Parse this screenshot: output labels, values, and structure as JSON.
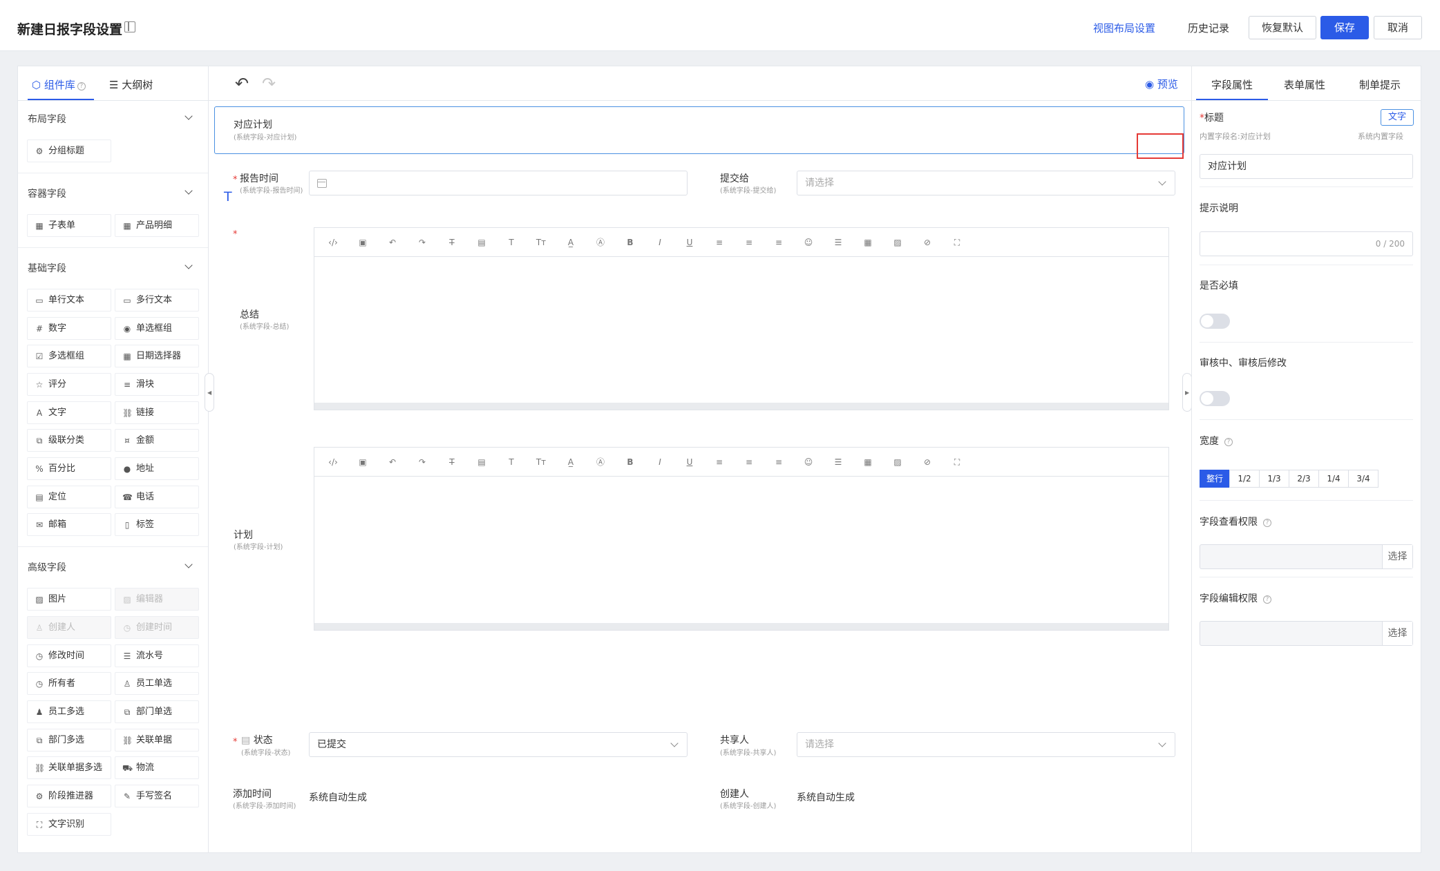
{
  "header": {
    "title": "新建日报字段设置",
    "view_layout": "视图布局设置",
    "history": "历史记录",
    "restore": "恢复默认",
    "save": "保存",
    "cancel": "取消",
    "accent": "#2b5be7"
  },
  "left": {
    "tabs": [
      "组件库",
      "大纲树"
    ],
    "sections": {
      "layout": {
        "title": "布局字段",
        "items": [
          "分组标题"
        ]
      },
      "container": {
        "title": "容器字段",
        "items": [
          "子表单",
          "产品明细"
        ]
      },
      "basic": {
        "title": "基础字段",
        "items": [
          "单行文本",
          "多行文本",
          "数字",
          "单选框组",
          "多选框组",
          "日期选择器",
          "评分",
          "滑块",
          "文字",
          "链接",
          "级联分类",
          "金额",
          "百分比",
          "地址",
          "定位",
          "电话",
          "邮箱",
          "标签"
        ]
      },
      "advanced": {
        "title": "高级字段",
        "items": [
          "图片",
          "编辑器",
          "创建人",
          "创建时间",
          "修改时间",
          "流水号",
          "所有者",
          "员工单选",
          "员工多选",
          "部门单选",
          "部门多选",
          "关联单据",
          "关联单据多选",
          "物流",
          "阶段推进器",
          "手写签名",
          "文字识别"
        ]
      }
    }
  },
  "center": {
    "preview": "预览",
    "plan_card": {
      "label": "对应计划",
      "sub": "(系统字段-对应计划)"
    },
    "report_time": {
      "label": "报告时间",
      "sub": "(系统字段-报告时间)"
    },
    "submit_to": {
      "label": "提交给",
      "sub": "(系统字段-提交给)",
      "placeholder": "请选择"
    },
    "summary": {
      "label": "总结",
      "sub": "(系统字段-总结)"
    },
    "plan": {
      "label": "计划",
      "sub": "(系统字段-计划)"
    },
    "status": {
      "label": "状态",
      "sub": "(系统字段-状态)",
      "value": "已提交"
    },
    "sharer": {
      "label": "共享人",
      "sub": "(系统字段-共享人)",
      "placeholder": "请选择"
    },
    "add_time": {
      "label": "添加时间",
      "sub": "(系统字段-添加时间)",
      "value": "系统自动生成"
    },
    "creator": {
      "label": "创建人",
      "sub": "(系统字段-创建人)",
      "value": "系统自动生成"
    }
  },
  "right": {
    "tabs": [
      "字段属性",
      "表单属性",
      "制单提示"
    ],
    "title_label": "标题",
    "text_tag": "文字",
    "builtin_name": "内置字段名:对应计划",
    "system_builtin": "系统内置字段",
    "title_value": "对应计划",
    "hint_label": "提示说明",
    "hint_counter": "0 / 200",
    "required_label": "是否必填",
    "edit_label": "审核中、审核后修改",
    "width_label": "宽度",
    "width_options": [
      "整行",
      "1/2",
      "1/3",
      "2/3",
      "1/4",
      "3/4"
    ],
    "view_perm_label": "字段查看权限",
    "edit_perm_label": "字段编辑权限",
    "select_btn": "选择"
  }
}
